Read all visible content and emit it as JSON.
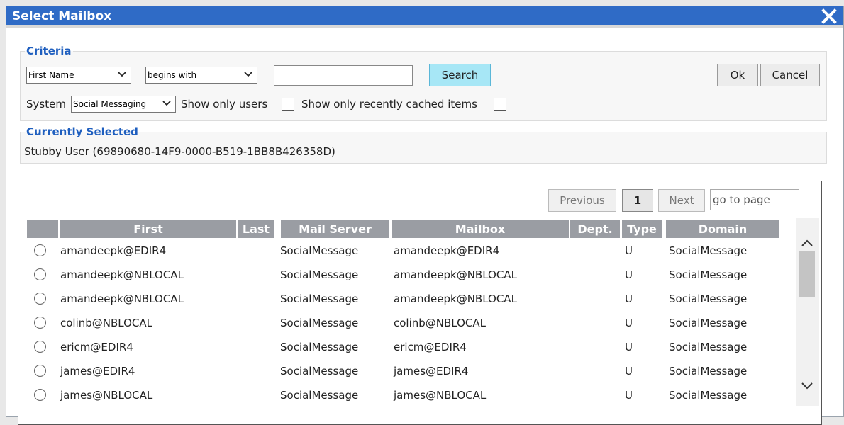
{
  "dialog": {
    "title": "Select Mailbox",
    "close_icon": "close-icon"
  },
  "criteria": {
    "legend": "Criteria",
    "field_select": "First Name",
    "operator_select": "begins with",
    "search_value": "",
    "search_label": "Search",
    "system_label": "System",
    "system_select": "Social Messaging",
    "show_only_users_label": "Show only users",
    "show_recent_label": "Show only recently cached items",
    "ok_label": "Ok",
    "cancel_label": "Cancel"
  },
  "selected": {
    "legend": "Currently Selected",
    "value": "Stubby User (69890680-14F9-0000-B519-1BB8B426358D)"
  },
  "pager": {
    "previous": "Previous",
    "current_page": "1",
    "next": "Next",
    "goto_placeholder": "go to page"
  },
  "table": {
    "columns": [
      "First",
      "Last",
      "Mail Server",
      "Mailbox",
      "Dept.",
      "Type",
      "Domain"
    ],
    "rows": [
      {
        "first": "amandeepk@EDIR4",
        "last": "",
        "server": "SocialMessage",
        "mailbox": "amandeepk@EDIR4",
        "dept": "",
        "type": "U",
        "domain": "SocialMessage"
      },
      {
        "first": "amandeepk@NBLOCAL",
        "last": "",
        "server": "SocialMessage",
        "mailbox": "amandeepk@NBLOCAL",
        "dept": "",
        "type": "U",
        "domain": "SocialMessage"
      },
      {
        "first": "amandeepk@NBLOCAL",
        "last": "",
        "server": "SocialMessage",
        "mailbox": "amandeepk@NBLOCAL",
        "dept": "",
        "type": "U",
        "domain": "SocialMessage"
      },
      {
        "first": "colinb@NBLOCAL",
        "last": "",
        "server": "SocialMessage",
        "mailbox": "colinb@NBLOCAL",
        "dept": "",
        "type": "U",
        "domain": "SocialMessage"
      },
      {
        "first": "ericm@EDIR4",
        "last": "",
        "server": "SocialMessage",
        "mailbox": "ericm@EDIR4",
        "dept": "",
        "type": "U",
        "domain": "SocialMessage"
      },
      {
        "first": "james@EDIR4",
        "last": "",
        "server": "SocialMessage",
        "mailbox": "james@EDIR4",
        "dept": "",
        "type": "U",
        "domain": "SocialMessage"
      },
      {
        "first": "james@NBLOCAL",
        "last": "",
        "server": "SocialMessage",
        "mailbox": "james@NBLOCAL",
        "dept": "",
        "type": "U",
        "domain": "SocialMessage"
      }
    ]
  },
  "colors": {
    "title_bar": "#2f6bc6",
    "legend_text": "#1f5fbf",
    "search_button": "#a7e7f6",
    "header_bg": "#9a9da3"
  }
}
